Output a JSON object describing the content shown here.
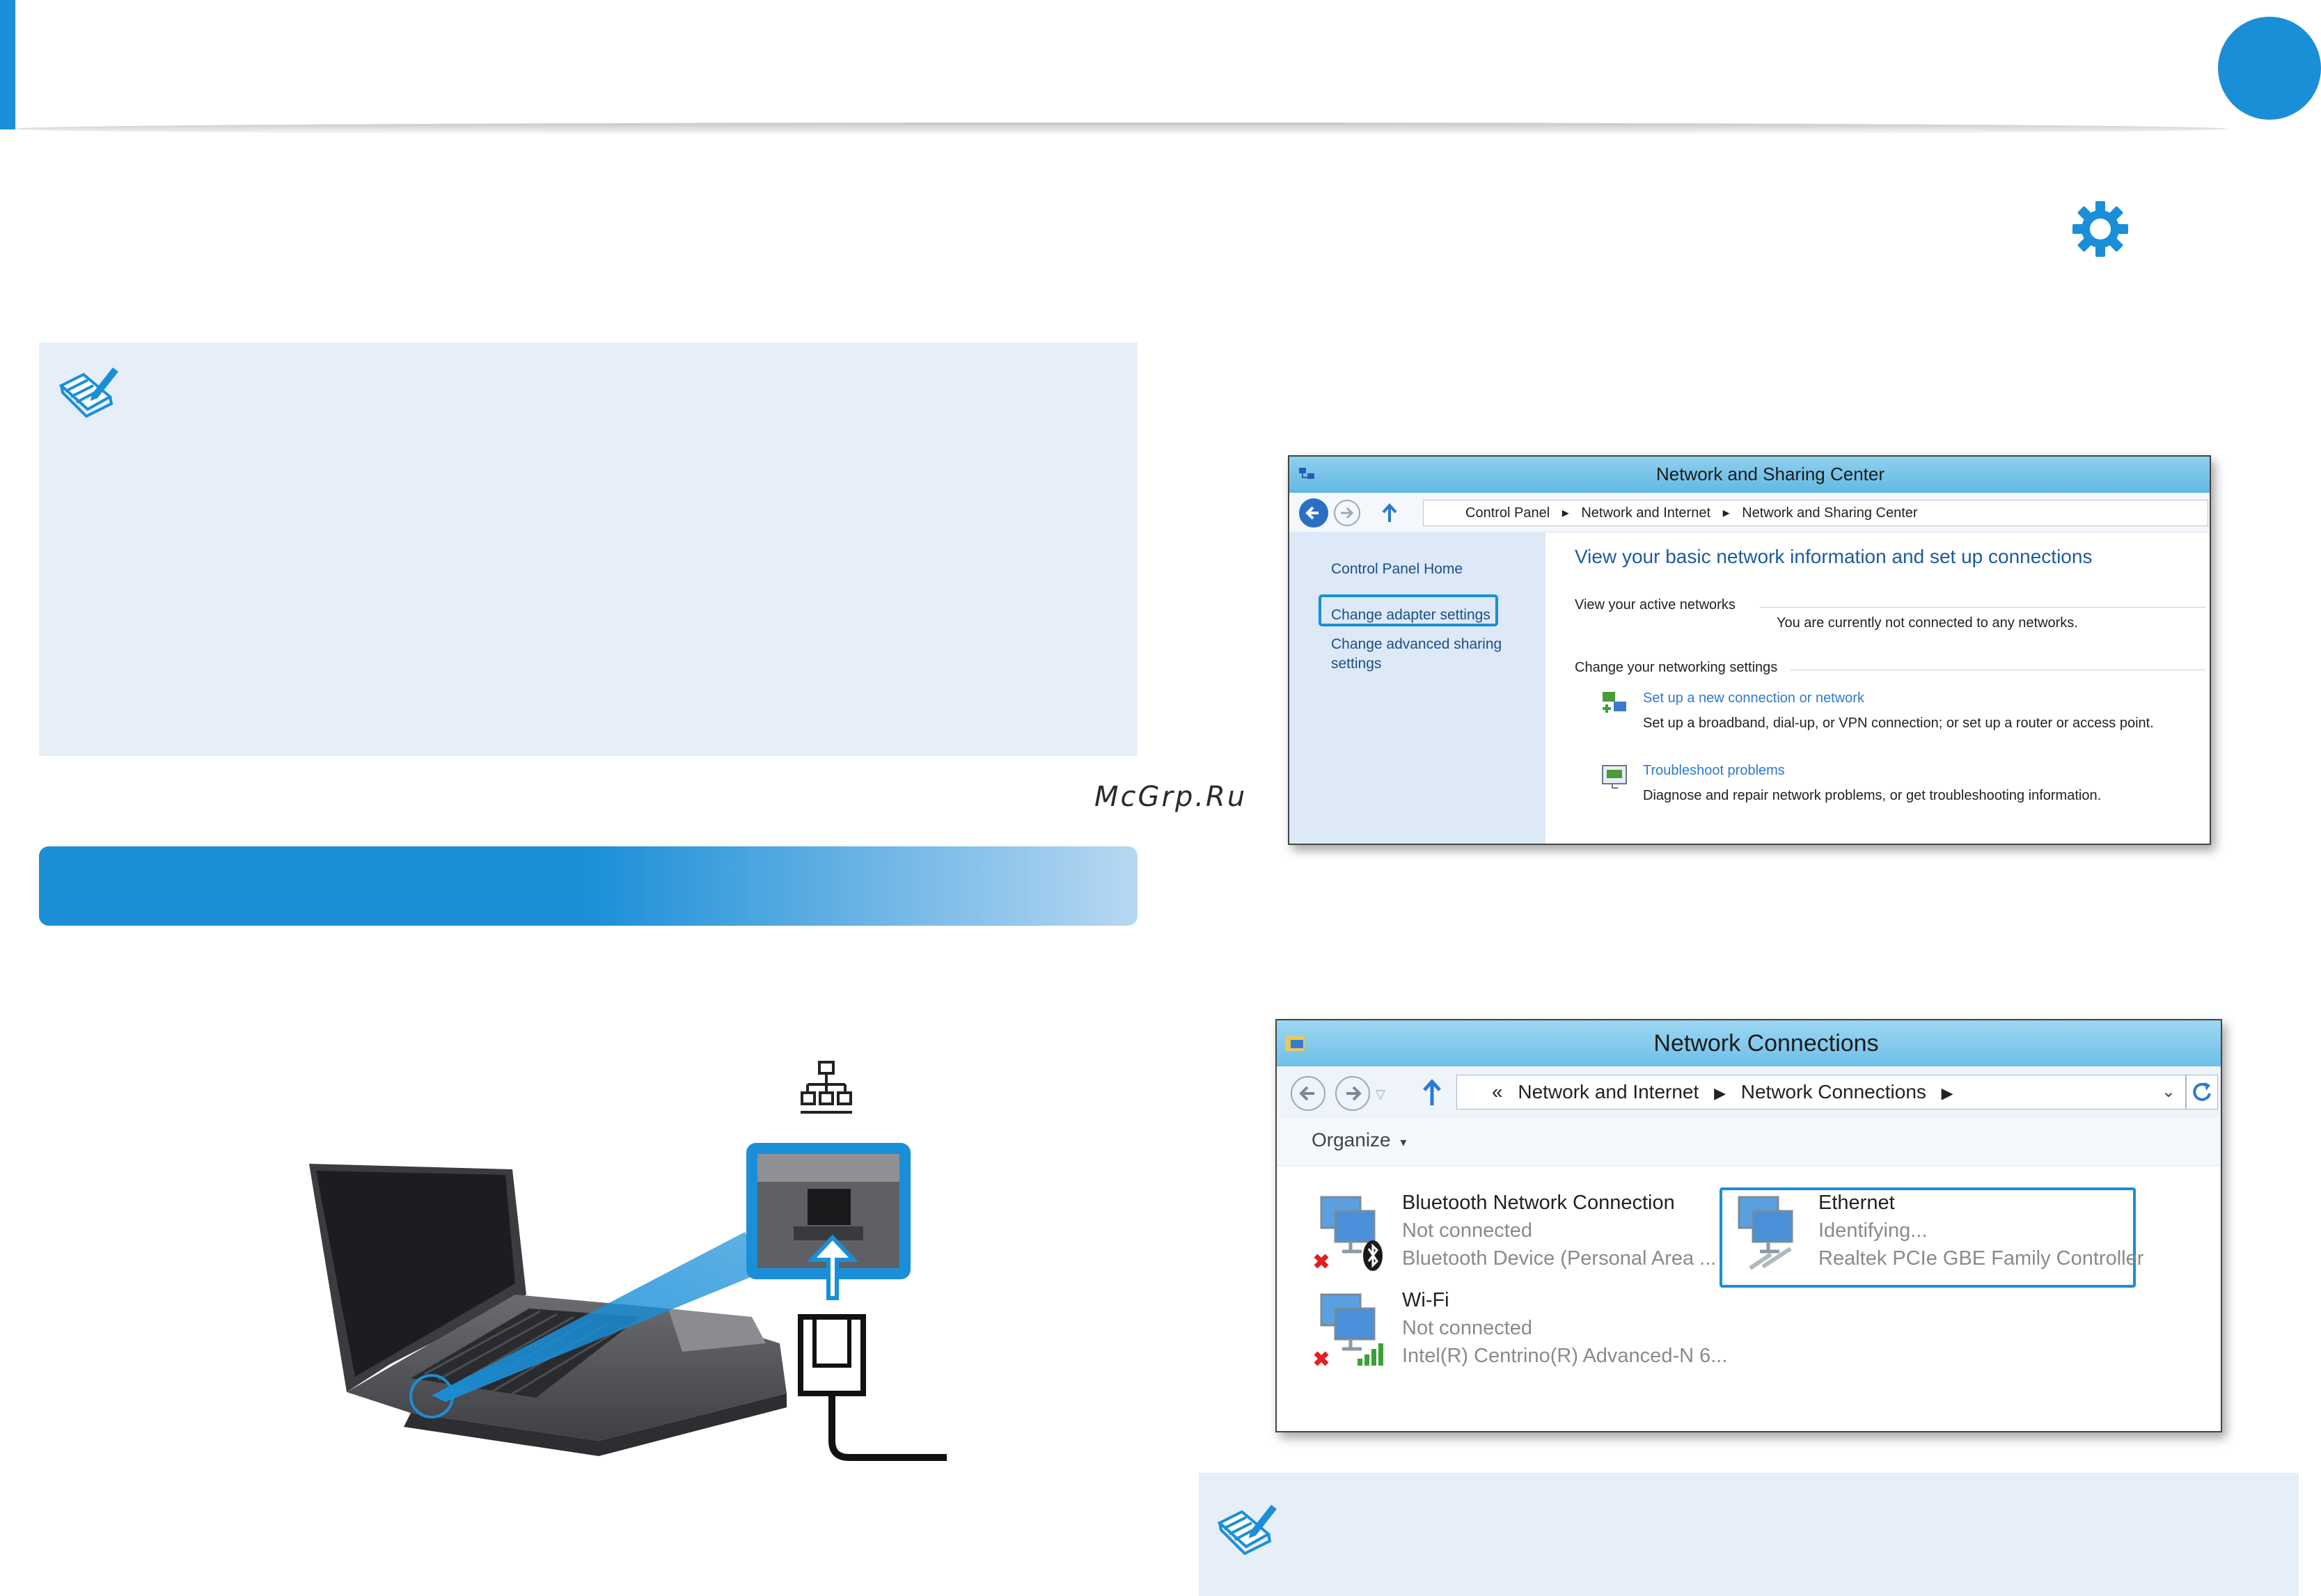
{
  "watermark": "McGrp.Ru",
  "colors": {
    "accent": "#1a8fd8",
    "note_bg": "#e6eef8",
    "highlight": "#1a8fd8"
  },
  "icons": [
    "note-icon",
    "gear-icon",
    "lan-port-icon",
    "ethernet-cable-icon"
  ],
  "network_sharing_center": {
    "title": "Network and Sharing Center",
    "breadcrumb": [
      "Control Panel",
      "Network and Internet",
      "Network and Sharing Center"
    ],
    "sidebar": {
      "home": "Control Panel Home",
      "adapter": "Change adapter settings",
      "advanced_line1": "Change advanced sharing",
      "advanced_line2": "settings"
    },
    "heading": "View your basic network information and set up connections",
    "active_networks_label": "View your active networks",
    "not_connected": "You are currently not connected to any networks.",
    "change_settings_label": "Change your networking settings",
    "setup_link": "Set up a new connection or network",
    "setup_desc": "Set up a broadband, dial-up, or VPN connection; or set up a router or access point.",
    "troubleshoot_link": "Troubleshoot problems",
    "troubleshoot_desc": "Diagnose and repair network problems, or get troubleshooting information."
  },
  "network_connections": {
    "title": "Network Connections",
    "breadcrumb_prefix": "«",
    "breadcrumb": [
      "Network and Internet",
      "Network Connections"
    ],
    "organize": "Organize",
    "items": [
      {
        "name": "Bluetooth Network Connection",
        "status": "Not connected",
        "device": "Bluetooth Device (Personal Area ..."
      },
      {
        "name": "Ethernet",
        "status": "Identifying...",
        "device": "Realtek PCIe GBE Family Controller"
      },
      {
        "name": "Wi-Fi",
        "status": "Not connected",
        "device": "Intel(R) Centrino(R) Advanced-N 6..."
      }
    ]
  }
}
